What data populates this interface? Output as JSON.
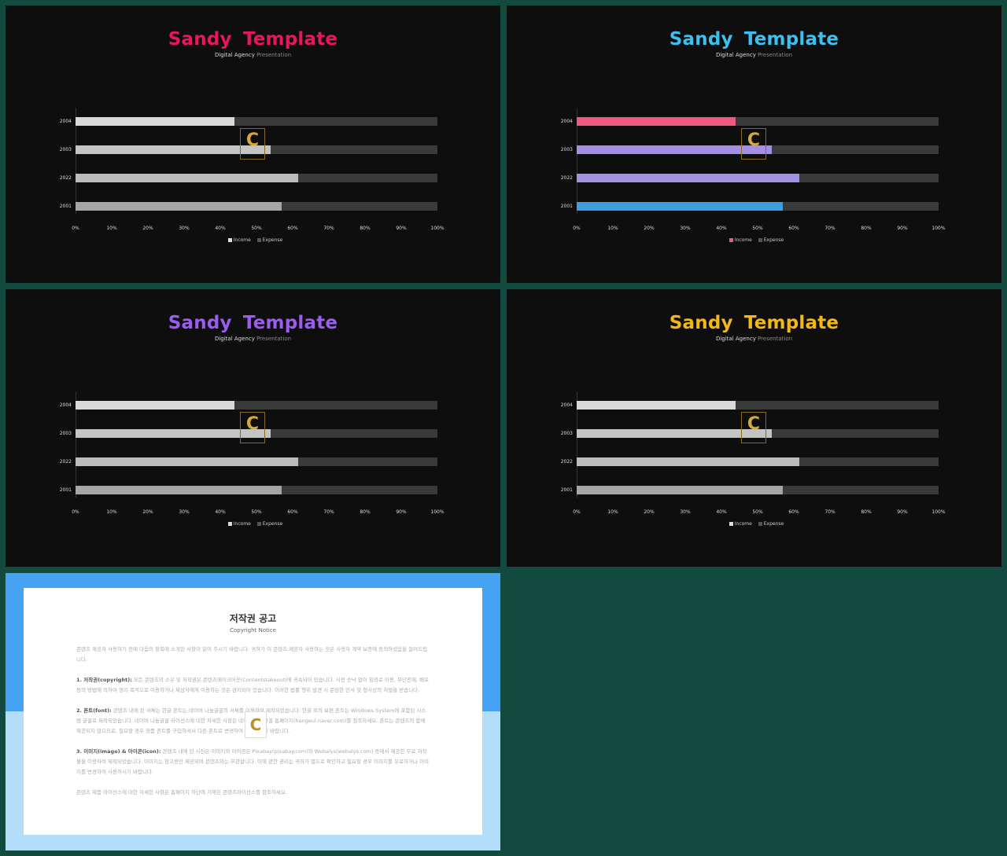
{
  "slides": [
    {
      "title": "Sandy  Template",
      "title_color": "#e8175d",
      "subtitle_bold": "Digital Agency",
      "subtitle_rest": "Presentation",
      "chart_data": {
        "type": "bar",
        "orientation": "horizontal",
        "stacked_percent": true,
        "categories": [
          "2004",
          "2003",
          "2022",
          "2001"
        ],
        "series": [
          {
            "name": "Income",
            "values": [
              44,
              54,
              61.5,
              57
            ]
          },
          {
            "name": "Expense",
            "values": [
              56,
              46,
              38.5,
              43
            ]
          }
        ],
        "xlim": [
          0,
          100
        ],
        "x_ticks": [
          "0%",
          "10%",
          "20%",
          "30%",
          "40%",
          "50%",
          "60%",
          "70%",
          "80%",
          "90%",
          "100%"
        ],
        "legend": "bottom",
        "bar_colors": [
          "#d9d9d9",
          "#c4c4c4",
          "#bcbcbc",
          "#a6a6a6"
        ],
        "expense_color": "#3a3a3a"
      }
    },
    {
      "title": "Sandy  Template",
      "title_color": "#3cc0ef",
      "subtitle_bold": "Digital Agency",
      "subtitle_rest": "Presentation",
      "chart_data": {
        "type": "bar",
        "orientation": "horizontal",
        "stacked_percent": true,
        "categories": [
          "2004",
          "2003",
          "2022",
          "2001"
        ],
        "series": [
          {
            "name": "Income",
            "values": [
              44,
              54,
              61.5,
              57
            ]
          },
          {
            "name": "Expense",
            "values": [
              56,
              46,
              38.5,
              43
            ]
          }
        ],
        "xlim": [
          0,
          100
        ],
        "x_ticks": [
          "0%",
          "10%",
          "20%",
          "30%",
          "40%",
          "50%",
          "60%",
          "70%",
          "80%",
          "90%",
          "100%"
        ],
        "legend": "bottom",
        "bar_colors": [
          "#f0587f",
          "#a38fe3",
          "#a38fe3",
          "#3c9fdc"
        ],
        "expense_color": "#3a3a3a",
        "legend_color": "#f0587f"
      }
    },
    {
      "title": "Sandy  Template",
      "title_color": "#9b5cf0",
      "subtitle_bold": "Digital Agency",
      "subtitle_rest": "Presentation",
      "chart_data": {
        "type": "bar",
        "orientation": "horizontal",
        "stacked_percent": true,
        "categories": [
          "2004",
          "2003",
          "2022",
          "2001"
        ],
        "series": [
          {
            "name": "Income",
            "values": [
              44,
              54,
              61.5,
              57
            ]
          },
          {
            "name": "Expense",
            "values": [
              56,
              46,
              38.5,
              43
            ]
          }
        ],
        "xlim": [
          0,
          100
        ],
        "x_ticks": [
          "0%",
          "10%",
          "20%",
          "30%",
          "40%",
          "50%",
          "60%",
          "70%",
          "80%",
          "90%",
          "100%"
        ],
        "legend": "bottom",
        "bar_colors": [
          "#d9d9d9",
          "#c4c4c4",
          "#bcbcbc",
          "#a6a6a6"
        ],
        "expense_color": "#3a3a3a"
      }
    },
    {
      "title": "Sandy  Template",
      "title_color": "#f5b713",
      "subtitle_bold": "Digital Agency",
      "subtitle_rest": "Presentation",
      "chart_data": {
        "type": "bar",
        "orientation": "horizontal",
        "stacked_percent": true,
        "categories": [
          "2004",
          "2003",
          "2022",
          "2001"
        ],
        "series": [
          {
            "name": "Income",
            "values": [
              44,
              54,
              61.5,
              57
            ]
          },
          {
            "name": "Expense",
            "values": [
              56,
              46,
              38.5,
              43
            ]
          }
        ],
        "xlim": [
          0,
          100
        ],
        "x_ticks": [
          "0%",
          "10%",
          "20%",
          "30%",
          "40%",
          "50%",
          "60%",
          "70%",
          "80%",
          "90%",
          "100%"
        ],
        "legend": "bottom",
        "bar_colors": [
          "#d9d9d9",
          "#c4c4c4",
          "#bcbcbc",
          "#a6a6a6"
        ],
        "expense_color": "#3a3a3a"
      }
    }
  ],
  "copyright": {
    "title": "저작권 공고",
    "subtitle": "Copyright Notice",
    "intro": "콘텐츠 제공자 사용하기 전에 다음의 항목에 소개된 사항이 읽어 주시기 바랍니다. 귀하가 이 콘텐츠 제공자 사용하는 것은 사용자 계약 보증에 동의하셨음을 알려드립니다.",
    "s1_head": "1. 저작권(copyright):",
    "s1_body": " 모든 콘텐츠의 소유 및 저작권은 콘텐츠메이크어웃(Contentstakeout)에 귀속되어 있습니다. 사전 승낙 없이 임의로 이용, 무단전재, 배포 등의 방법에 의하여 영리 목적으로 이용하거나 제삼자에게 이용하는 것은 금지되어 있습니다. 이러한 법률 행위 발견 시 준엄한 민사 및 형사상의 처벌을 받습니다.",
    "s2_head": "2. 폰트(font):",
    "s2_body": " 콘텐츠 내에 된 서체는 한글 폰트는 네이버 나눔글꼴의 서체를 이용하여 제작되었습니다. 한글 외의 보편 폰트는 Windows System에 포함된 시스템 글꼴로 제작되었습니다. 네이버 나눔글꼴 라이선스에 대한 자세한 사항은 네이버 나눔글꼴 홈페이지(hangeul.naver.com)를 참조하세요. 폰트는 콘텐츠의 함께 제공되지 않으므로, 필요할 경우 정품 폰트를 구입하셔서 다른 폰트로 변경하여 사용하시기 바랍니다.",
    "s3_head": "3. 이미지(image) & 아이콘(icon):",
    "s3_body": " 콘텐츠 내에 된 사진은 이미지와 아이콘은 Pixabay(pixabay.com)와 Webalys(webalys.com) 등에서 제공한 무료 저작물을 이용하여 제작되었습니다. 이미지는 참고용만 제공되며 콘텐츠와는 무관합니다. 이에 관한 권리는 귀하가 별도로 확인하고 필요할 경우 이미지를 유료하거나 이미지를 변경하여 사용하시기 바랍니다.",
    "footer": "콘텐츠 제품 라이선스에 대한 자세한 사항은 홈페이지 하단에 기재된 콘텐츠라이선스를 참조하세요.",
    "watermark": "C"
  },
  "watermark": "C"
}
